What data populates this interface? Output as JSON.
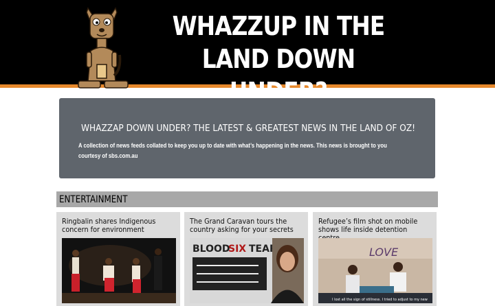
{
  "header": {
    "title": "WHAZZUP IN THE LAND DOWN UNDER?",
    "logo": "kangaroo-logo",
    "colors": {
      "background": "#000000",
      "stripe": "#e7892c"
    }
  },
  "intro": {
    "heading": "WHAZZAP DOWN UNDER? THE LATEST & GREATEST NEWS IN THE LAND OF OZ!",
    "text": "A collection of news feeds collated to keep you up to date with what’s happening in the news. This news is brought to you courtesy of sbs.com.au"
  },
  "section": {
    "title": "ENTERTAINMENT"
  },
  "cards": [
    {
      "title": "Ringbalin shares Indigenous concern for environment"
    },
    {
      "title": "The Grand Caravan tours the country asking for your secrets",
      "image_text": [
        "BLOOD",
        "SIX",
        "TEARS"
      ]
    },
    {
      "title": "Refugee’s film shot on mobile shows life inside detention centre",
      "image_text": [
        "I lost all the sign of stillness. I tried to adjust to my new",
        "LOVE"
      ]
    }
  ]
}
